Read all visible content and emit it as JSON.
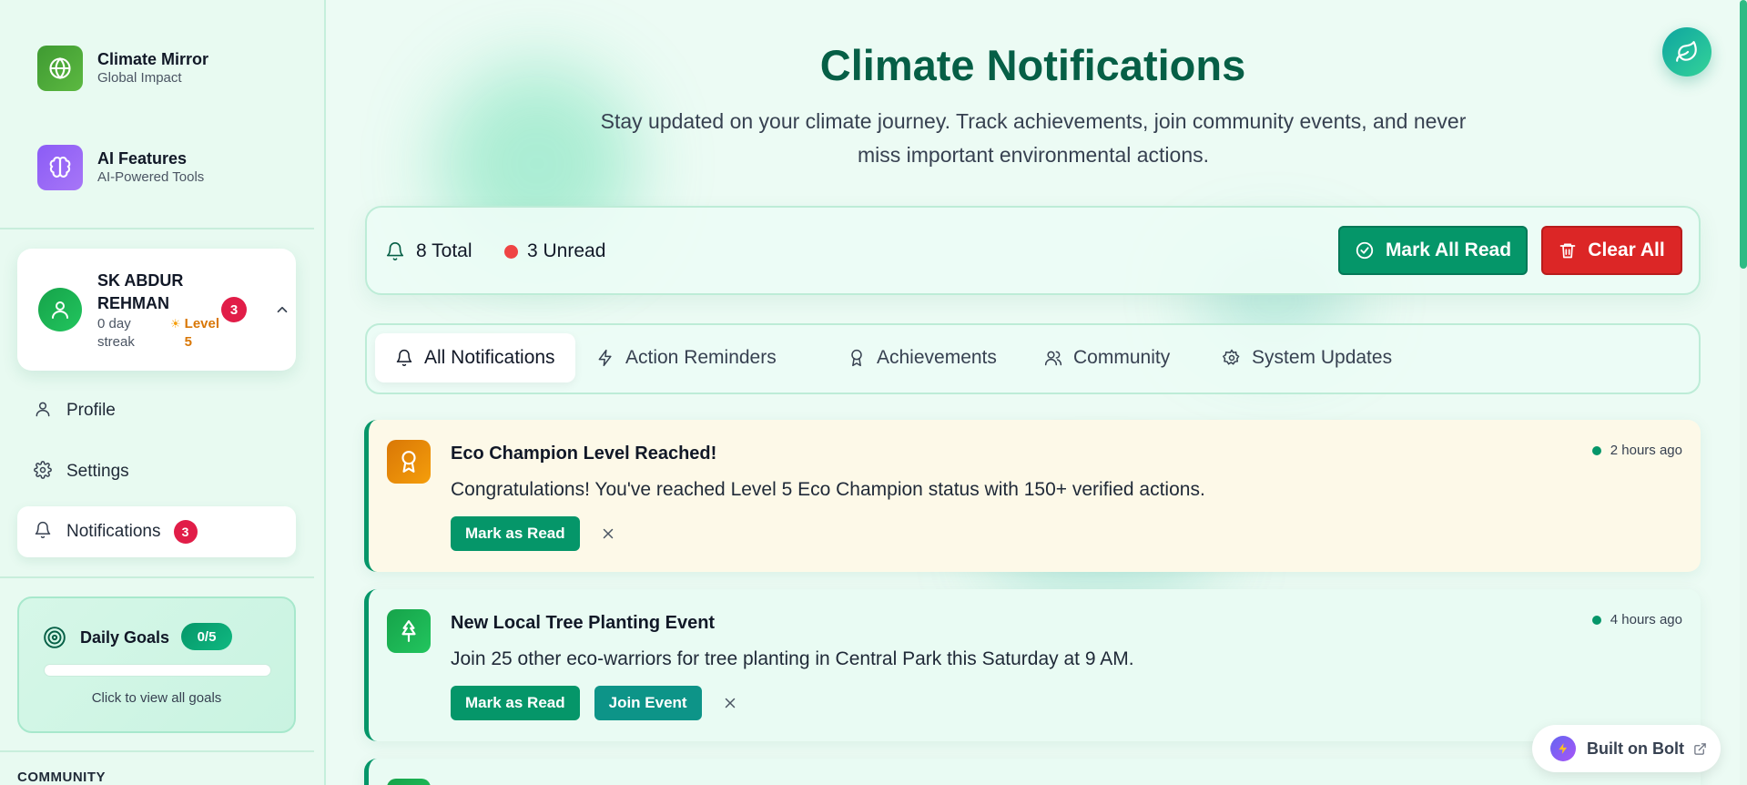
{
  "sidebar": {
    "brand1": {
      "title": "Climate Mirror",
      "subtitle": "Global Impact",
      "icon": "globe-icon"
    },
    "brand2": {
      "title": "AI Features",
      "subtitle": "AI-Powered Tools",
      "icon": "brain-icon"
    },
    "user": {
      "name": "SK ABDUR REHMAN",
      "streak": "0 day streak",
      "level": "Level 5",
      "badge": "3"
    },
    "nav": [
      {
        "label": "Profile",
        "icon": "user-icon"
      },
      {
        "label": "Settings",
        "icon": "gear-icon"
      },
      {
        "label": "Notifications",
        "icon": "bell-icon",
        "badge": "3"
      }
    ],
    "goals": {
      "title": "Daily Goals",
      "count": "0/5",
      "progress": 0,
      "hint": "Click to view all goals"
    },
    "section_label": "COMMUNITY"
  },
  "main": {
    "title": "Climate Notifications",
    "subtitle": "Stay updated on your climate journey. Track achievements, join community events, and never miss important environmental actions.",
    "stats": {
      "total": "8 Total",
      "unread": "3 Unread"
    },
    "buttons": {
      "mark_all": "Mark All Read",
      "clear_all": "Clear All"
    },
    "tabs": [
      {
        "label": "All Notifications",
        "icon": "bell-icon"
      },
      {
        "label": "Action Reminders",
        "icon": "lightning-icon"
      },
      {
        "label": "Achievements",
        "icon": "award-icon"
      },
      {
        "label": "Community",
        "icon": "users-icon"
      },
      {
        "label": "System Updates",
        "icon": "gear-icon"
      }
    ],
    "notifications": [
      {
        "title": "Eco Champion Level Reached!",
        "body": "Congratulations! You've reached Level 5 Eco Champion status with 150+ verified actions.",
        "time": "2 hours ago",
        "mark_label": "Mark as Read"
      },
      {
        "title": "New Local Tree Planting Event",
        "body": "Join 25 other eco-warriors for tree planting in Central Park this Saturday at 9 AM.",
        "time": "4 hours ago",
        "mark_label": "Mark as Read",
        "extra_label": "Join Event"
      }
    ]
  },
  "bolt": {
    "label": "Built on Bolt"
  },
  "colors": {
    "accent": "#059669",
    "title": "#065f46",
    "danger": "#dc2626",
    "badge": "#e11d48",
    "achievement_bg": "#fdf9e8"
  }
}
